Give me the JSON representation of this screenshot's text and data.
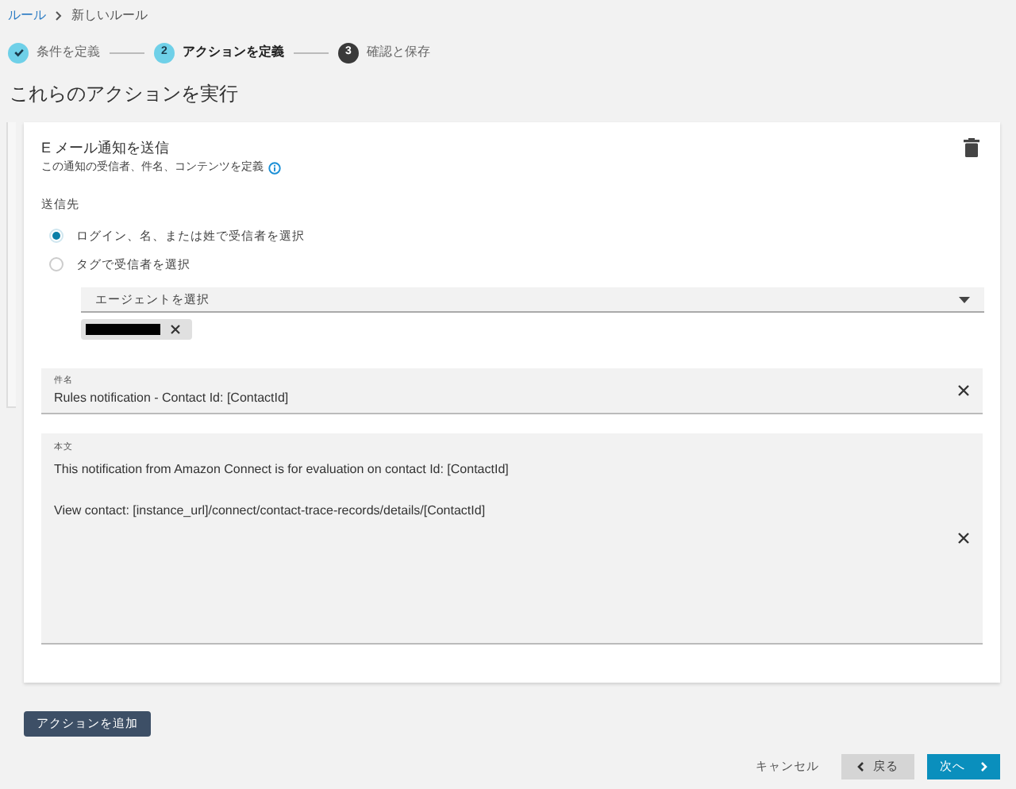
{
  "breadcrumb": [
    {
      "label": "ルール",
      "link": true
    },
    {
      "label": "新しいルール",
      "link": false
    }
  ],
  "steps": [
    {
      "label": "条件を定義",
      "completed": true,
      "selected": false
    },
    {
      "number": "2",
      "label": "アクションを定義",
      "completed": false,
      "selected": true
    },
    {
      "number": "3",
      "label": "確認と保存",
      "completed": false,
      "selected": false
    }
  ],
  "heading": "これらのアクションを実行",
  "action": {
    "title": "E メール通知を送信",
    "description": "この通知の受信者、件名、コンテンツを定義",
    "recipients_label": "送信先",
    "options": [
      {
        "label": "ログイン、名、または姓で受信者を選択",
        "selected": true
      },
      {
        "label": "タグで受信者を選択",
        "selected": false
      }
    ],
    "agent_select": {
      "placeholder": "エージェントを選択"
    },
    "subject": {
      "label": "件名",
      "value": "Rules notification - Contact Id: [ContactId]"
    },
    "body": {
      "label": "本文",
      "paragraphs": [
        "This notification from Amazon Connect is for evaluation on contact Id: [ContactId]",
        "View contact: [instance_url]/connect/contact-trace-records/details/[ContactId]"
      ]
    }
  },
  "add_action": "アクションを追加",
  "footer": {
    "cancel": "キャンセル",
    "back": "戻る",
    "next": "次へ"
  }
}
